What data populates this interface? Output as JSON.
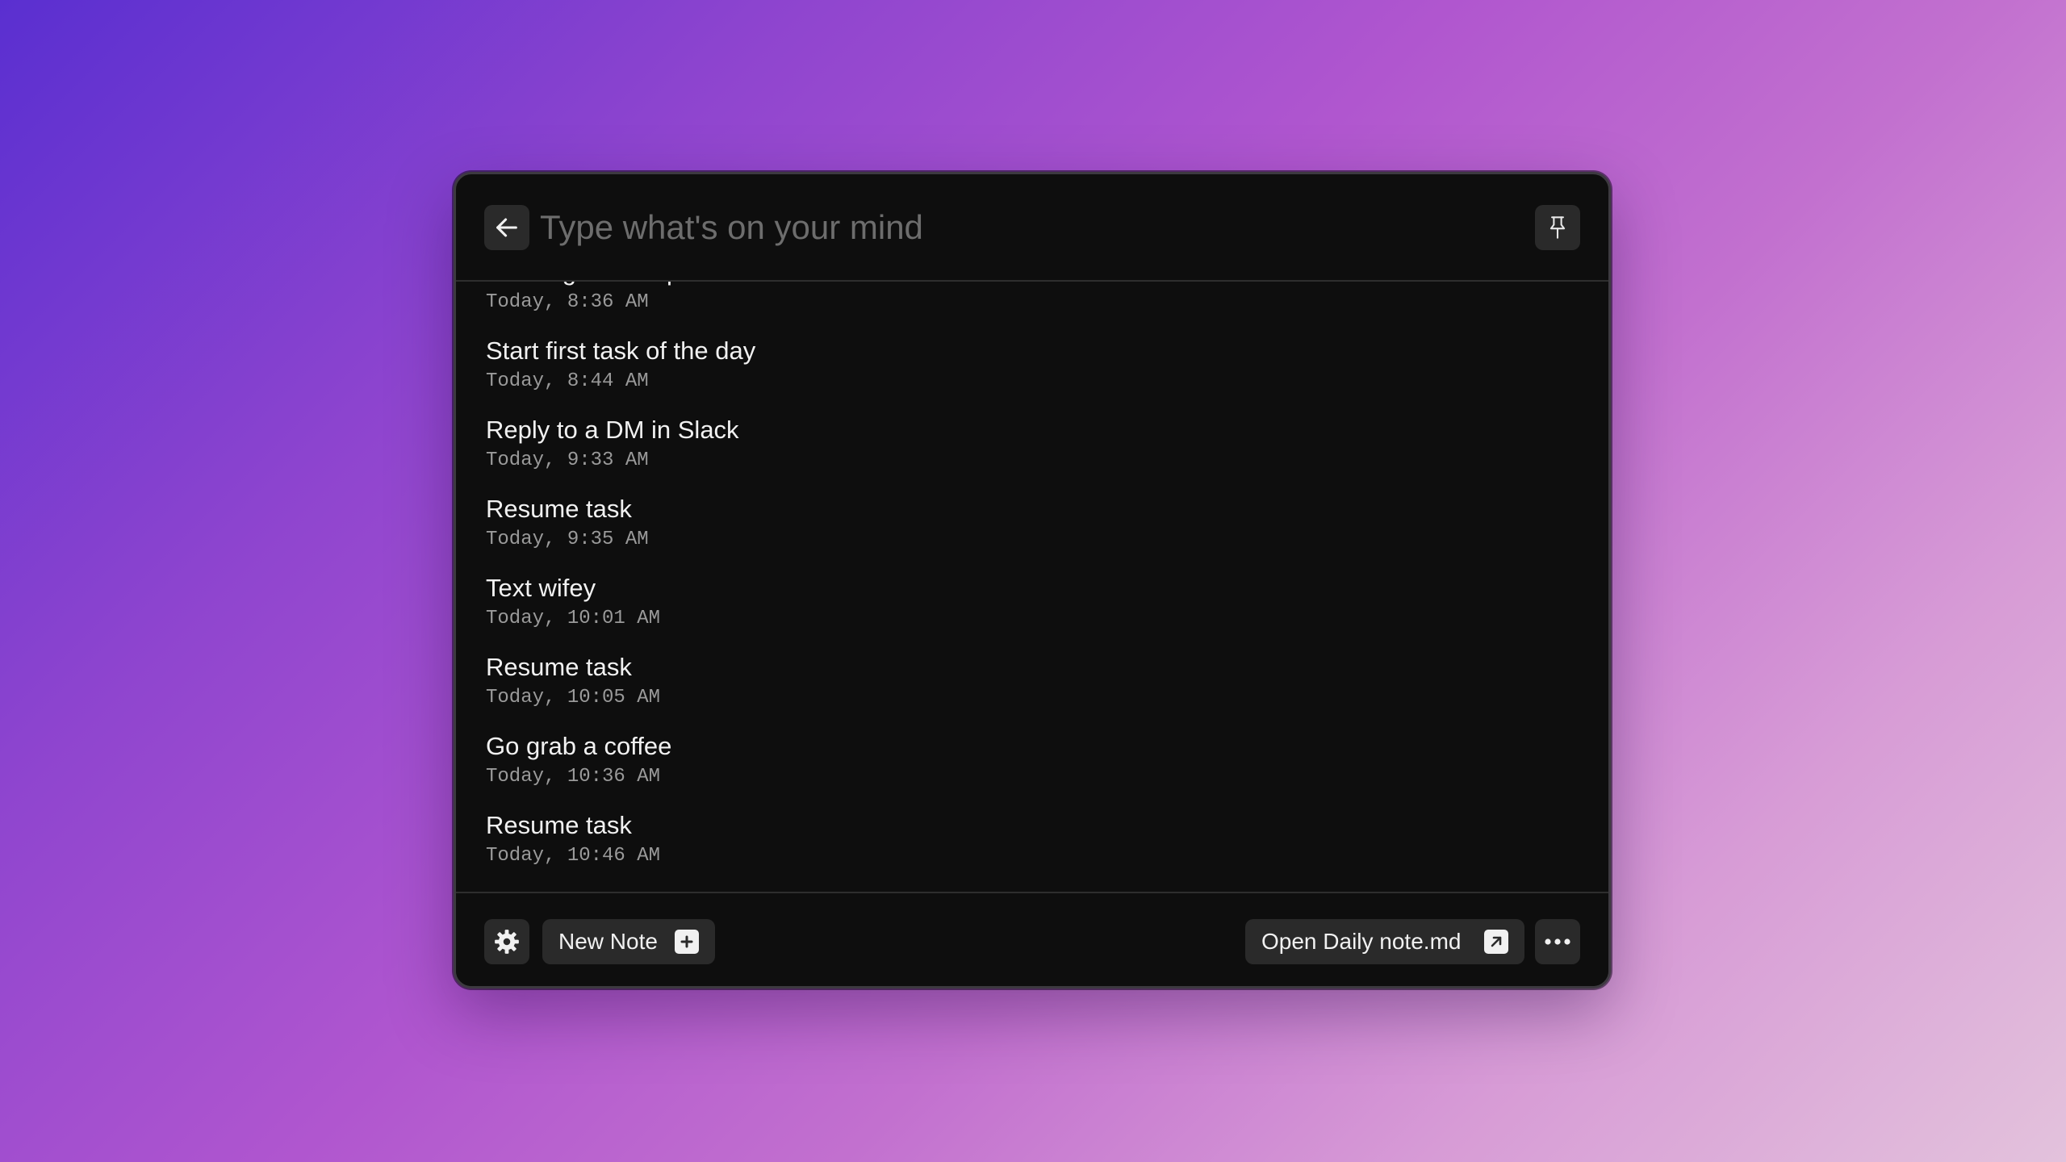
{
  "search": {
    "placeholder": "Type what's on your mind",
    "value": ""
  },
  "header": {
    "back_icon": "arrow-left-icon",
    "pin_icon": "pin-icon"
  },
  "notes": [
    {
      "title": "Morning stand-up",
      "time": "Today, 8:36 AM"
    },
    {
      "title": "Start first task of the day",
      "time": "Today, 8:44 AM"
    },
    {
      "title": "Reply to a DM in Slack",
      "time": "Today, 9:33 AM"
    },
    {
      "title": "Resume task",
      "time": "Today, 9:35 AM"
    },
    {
      "title": "Text wifey",
      "time": "Today, 10:01 AM"
    },
    {
      "title": "Resume task",
      "time": "Today, 10:05 AM"
    },
    {
      "title": "Go grab a coffee",
      "time": "Today, 10:36 AM"
    },
    {
      "title": "Resume task",
      "time": "Today, 10:46 AM"
    }
  ],
  "footer": {
    "settings_icon": "gear-icon",
    "new_note_label": "New Note",
    "new_note_icon": "plus-icon",
    "open_daily_label": "Open Daily note.md",
    "open_daily_icon": "external-arrow-icon",
    "more_icon": "ellipsis-icon"
  },
  "colors": {
    "window_bg": "#0e0e0e",
    "button_bg": "#2a2a2a",
    "text": "#f1f1f1",
    "muted": "#9a9a9a",
    "placeholder": "#6d6d6d"
  }
}
